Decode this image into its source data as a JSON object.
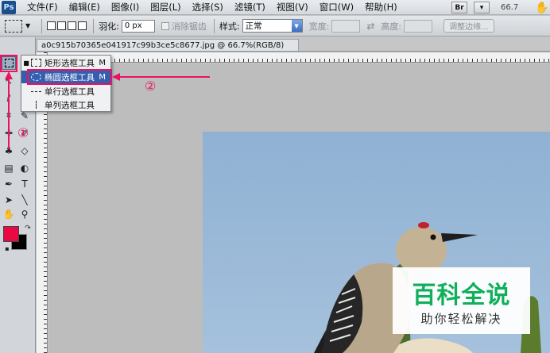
{
  "app": {
    "logo": "Ps"
  },
  "menu": [
    "文件(F)",
    "编辑(E)",
    "图像(I)",
    "图层(L)",
    "选择(S)",
    "滤镜(T)",
    "视图(V)",
    "窗口(W)",
    "帮助(H)"
  ],
  "menu_right": {
    "bridge_label": "Br",
    "zoom": "66.7",
    "hand_icon": "hand-icon"
  },
  "options": {
    "feather_label": "羽化:",
    "feather_value": "0 px",
    "antialias_label": "消除锯齿",
    "style_label": "样式:",
    "style_value": "正常",
    "width_label": "宽度:",
    "height_label": "高度:",
    "refine_label": "调整边缘..."
  },
  "document": {
    "tab_title": "a0c915b70365e041917c99b3ce5c8677.jpg @ 66.7%(RGB/8)"
  },
  "flyout": {
    "items": [
      {
        "label": "矩形选框工具",
        "shortcut": "M",
        "active": true
      },
      {
        "label": "椭圆选框工具",
        "shortcut": "M",
        "highlighted": true
      },
      {
        "label": "单行选框工具",
        "shortcut": ""
      },
      {
        "label": "单列选框工具",
        "shortcut": ""
      }
    ]
  },
  "annotations": {
    "step1": "①",
    "step2": "②"
  },
  "colors": {
    "foreground": "#ea0a43",
    "background": "#000000",
    "annotation": "#ea1261",
    "highlight": "#355fae"
  },
  "watermark": {
    "title": "百科全说",
    "subtitle": "助你轻松解决"
  }
}
